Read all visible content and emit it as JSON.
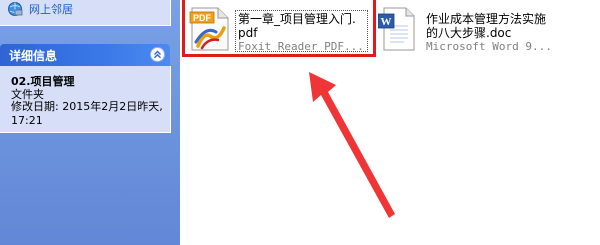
{
  "sidebar": {
    "network_places": "网上邻居",
    "details": {
      "title": "详细信息",
      "name": "02.项目管理",
      "type": "文件夹",
      "modified": "修改日期: 2015年2月2日昨天, 17:21"
    }
  },
  "files": [
    {
      "name_line1": "第一章_项目管理入门.",
      "name_line2": "pdf",
      "type": "Foxit Reader PDF...",
      "icon": "pdf-icon",
      "selected": true
    },
    {
      "name_line1": "作业成本管理方法实施",
      "name_line2": "的八大步骤.doc",
      "type": "Microsoft Word 9...",
      "icon": "word-icon",
      "selected": false
    }
  ],
  "colors": {
    "highlight": "#e21a1a",
    "sidebar_bg": "#6b93dd",
    "header": "#2f64d4",
    "panel": "#d6dff7"
  },
  "icons": {
    "pdf_badge": "PDF",
    "word_badge": "W"
  }
}
